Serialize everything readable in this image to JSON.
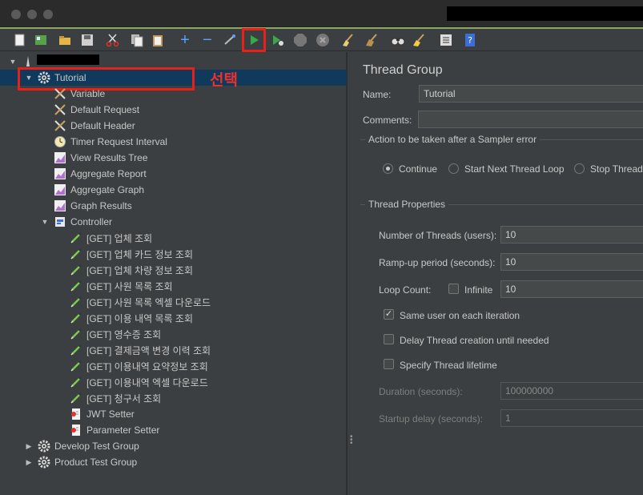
{
  "window": {
    "redacted_title": ""
  },
  "toolbar": {
    "items": [
      {
        "name": "new-icon"
      },
      {
        "name": "templates-icon"
      },
      {
        "name": "open-icon"
      },
      {
        "name": "save-icon"
      },
      {
        "name": "cut-icon"
      },
      {
        "name": "copy-icon"
      },
      {
        "name": "paste-icon"
      },
      {
        "name": "expand-icon"
      },
      {
        "name": "collapse-icon"
      },
      {
        "name": "toggle-icon"
      },
      {
        "name": "start-icon"
      },
      {
        "name": "start-no-pauses-icon"
      },
      {
        "name": "stop-icon"
      },
      {
        "name": "shutdown-icon"
      },
      {
        "name": "clear-icon"
      },
      {
        "name": "clear-all-icon"
      },
      {
        "name": "search-icon"
      },
      {
        "name": "reset-search-icon"
      },
      {
        "name": "function-helper-icon"
      },
      {
        "name": "help-icon"
      }
    ]
  },
  "annotation": {
    "text": "선택"
  },
  "tree": {
    "group": "Tutorial",
    "items": [
      {
        "label": "Variable"
      },
      {
        "label": "Default Request"
      },
      {
        "label": "Default Header"
      },
      {
        "label": "Timer Request Interval"
      },
      {
        "label": "View Results Tree"
      },
      {
        "label": "Aggregate Report"
      },
      {
        "label": "Aggregate Graph"
      },
      {
        "label": "Graph Results"
      }
    ],
    "controller": "Controller",
    "requests": [
      {
        "label": "[GET] 업체 조회"
      },
      {
        "label": "[GET] 업체 카드 정보 조회"
      },
      {
        "label": "[GET] 업체 차량 정보 조회"
      },
      {
        "label": "[GET] 사원 목록 조회"
      },
      {
        "label": "[GET] 사원 목록 엑셀 다운로드"
      },
      {
        "label": "[GET] 이용 내역 목록 조회"
      },
      {
        "label": "[GET] 영수증 조회"
      },
      {
        "label": "[GET] 결제금액 변경 이력 조회"
      },
      {
        "label": "[GET] 이용내역 요약정보 조회"
      },
      {
        "label": "[GET] 이용내역 엑셀 다운로드"
      },
      {
        "label": "[GET] 청구서 조회"
      }
    ],
    "setters": [
      {
        "label": "JWT Setter"
      },
      {
        "label": "Parameter Setter"
      }
    ],
    "other_groups": [
      {
        "label": "Develop Test Group"
      },
      {
        "label": "Product Test Group"
      }
    ]
  },
  "panel": {
    "title": "Thread Group",
    "name_label": "Name:",
    "name_value": "Tutorial",
    "comments_label": "Comments:",
    "comments_value": "",
    "action_section": "Action to be taken after a Sampler error",
    "action_options": [
      "Continue",
      "Start Next Thread Loop",
      "Stop Thread"
    ],
    "selected_action": "Continue",
    "props_section": "Thread Properties",
    "threads_label": "Number of Threads (users):",
    "threads_value": "10",
    "rampup_label": "Ramp-up period (seconds):",
    "rampup_value": "10",
    "loop_label": "Loop Count:",
    "infinite_label": "Infinite",
    "infinite_checked": false,
    "loop_value": "10",
    "same_user_label": "Same user on each iteration",
    "same_user_checked": true,
    "delay_label": "Delay Thread creation until needed",
    "delay_checked": false,
    "lifetime_label": "Specify Thread lifetime",
    "lifetime_checked": false,
    "duration_label": "Duration (seconds):",
    "duration_value": "100000000",
    "startup_label": "Startup delay (seconds):",
    "startup_value": "1"
  }
}
